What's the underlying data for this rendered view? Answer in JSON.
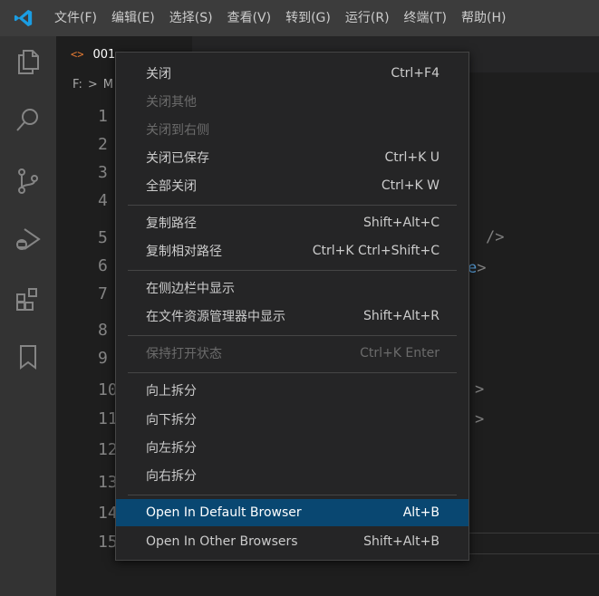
{
  "menubar": {
    "logo_icon": "vscode-logo-icon",
    "items": [
      "文件(F)",
      "编辑(E)",
      "选择(S)",
      "查看(V)",
      "转到(G)",
      "运行(R)",
      "终端(T)",
      "帮助(H)"
    ]
  },
  "activity": [
    "explorer-icon",
    "search-icon",
    "source-control-icon",
    "run-debug-icon",
    "extensions-icon",
    "bookmark-icon"
  ],
  "tab": {
    "icon": "<>",
    "label": "001"
  },
  "breadcrumb": {
    "drive": "F:",
    "sep": ">",
    "folder": "M"
  },
  "editor": {
    "line_numbers": [
      "1",
      "2",
      "3",
      "4",
      "5",
      "6",
      "7",
      "8",
      "9",
      "10",
      "11",
      "12",
      "13",
      "14",
      "15"
    ],
    "frag_5": "/>",
    "frag_6a": "e",
    "frag_6b": ">",
    "frag_10": ">",
    "frag_11": ">"
  },
  "context_menu": {
    "close": {
      "label": "关闭",
      "key": "Ctrl+F4"
    },
    "close_others": {
      "label": "关闭其他",
      "key": ""
    },
    "close_right": {
      "label": "关闭到右侧",
      "key": ""
    },
    "close_saved": {
      "label": "关闭已保存",
      "key": "Ctrl+K U"
    },
    "close_all": {
      "label": "全部关闭",
      "key": "Ctrl+K W"
    },
    "copy_path": {
      "label": "复制路径",
      "key": "Shift+Alt+C"
    },
    "copy_rel_path": {
      "label": "复制相对路径",
      "key": "Ctrl+K Ctrl+Shift+C"
    },
    "reveal_sidebar": {
      "label": "在侧边栏中显示",
      "key": ""
    },
    "reveal_explorer": {
      "label": "在文件资源管理器中显示",
      "key": "Shift+Alt+R"
    },
    "keep_open": {
      "label": "保持打开状态",
      "key": "Ctrl+K Enter"
    },
    "split_up": {
      "label": "向上拆分",
      "key": ""
    },
    "split_down": {
      "label": "向下拆分",
      "key": ""
    },
    "split_left": {
      "label": "向左拆分",
      "key": ""
    },
    "split_right": {
      "label": "向右拆分",
      "key": ""
    },
    "open_default": {
      "label": "Open In Default Browser",
      "key": "Alt+B"
    },
    "open_other": {
      "label": "Open In Other Browsers",
      "key": "Shift+Alt+B"
    }
  }
}
